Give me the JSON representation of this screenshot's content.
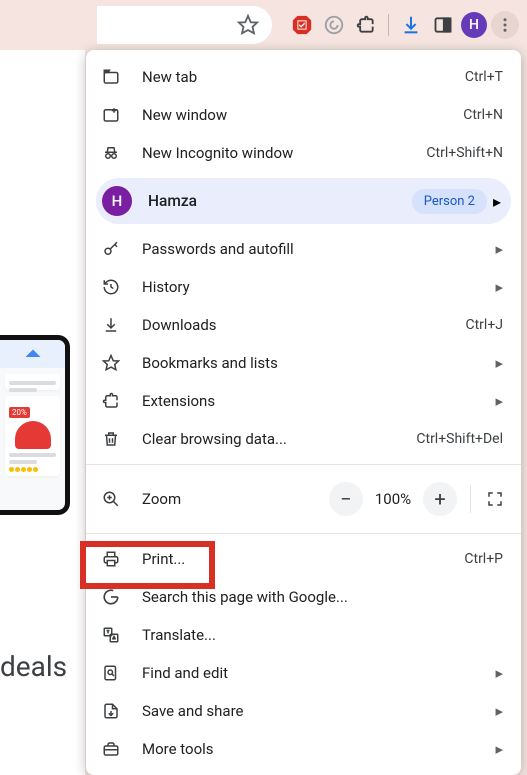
{
  "toolbar": {
    "avatar_letter": "H"
  },
  "menu": {
    "new_tab": {
      "label": "New tab",
      "shortcut": "Ctrl+T"
    },
    "new_window": {
      "label": "New window",
      "shortcut": "Ctrl+N"
    },
    "incognito": {
      "label": "New Incognito window",
      "shortcut": "Ctrl+Shift+N"
    },
    "profile": {
      "name": "Hamza",
      "tag": "Person 2",
      "initial": "H"
    },
    "passwords": {
      "label": "Passwords and autofill"
    },
    "history": {
      "label": "History"
    },
    "downloads": {
      "label": "Downloads",
      "shortcut": "Ctrl+J"
    },
    "bookmarks": {
      "label": "Bookmarks and lists"
    },
    "extensions": {
      "label": "Extensions"
    },
    "clear_data": {
      "label": "Clear browsing data...",
      "shortcut": "Ctrl+Shift+Del"
    },
    "zoom": {
      "label": "Zoom",
      "level": "100%"
    },
    "print": {
      "label": "Print...",
      "shortcut": "Ctrl+P"
    },
    "search_google": {
      "label": "Search this page with Google..."
    },
    "translate": {
      "label": "Translate..."
    },
    "find": {
      "label": "Find and edit"
    },
    "save_share": {
      "label": "Save and share"
    },
    "more_tools": {
      "label": "More tools"
    }
  },
  "page": {
    "deals_text": "deals",
    "badge": "20%"
  }
}
